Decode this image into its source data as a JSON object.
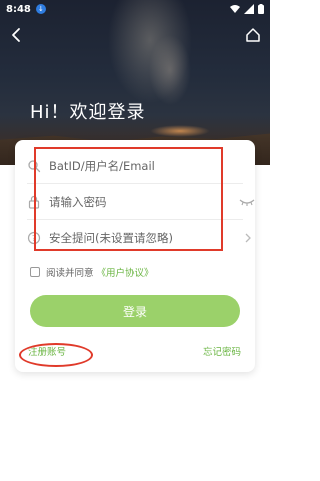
{
  "status_bar": {
    "time": "8:48",
    "download_glyph": "↓"
  },
  "header": {
    "greeting": "Hi！欢迎登录"
  },
  "form": {
    "account_placeholder": "BatID/用户名/Email",
    "password_placeholder": "请输入密码",
    "security_placeholder": "安全提问(未设置请忽略)"
  },
  "agreement": {
    "text": "阅读并同意",
    "link": "《用户协议》"
  },
  "login_button": "登录",
  "footer": {
    "register": "注册账号",
    "forgot": "忘记密码"
  },
  "colors": {
    "accent": "#6ab542",
    "button": "#9bd16a",
    "annotation": "#e03a2a"
  },
  "icons": [
    "back-arrow-icon",
    "home-icon",
    "search-icon",
    "lock-icon",
    "question-icon",
    "eye-closed-icon",
    "chevron-right-icon"
  ]
}
